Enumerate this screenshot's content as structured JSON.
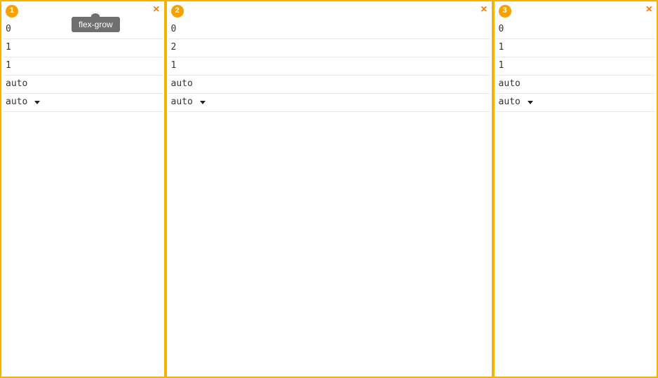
{
  "tooltip": "flex-grow",
  "columns": [
    {
      "index": "1",
      "close": "×",
      "fields": {
        "order": "0",
        "flex_grow": "1",
        "flex_shrink": "1",
        "flex_basis": "auto",
        "align_self": "auto"
      }
    },
    {
      "index": "2",
      "close": "×",
      "fields": {
        "order": "0",
        "flex_grow": "2",
        "flex_shrink": "1",
        "flex_basis": "auto",
        "align_self": "auto"
      }
    },
    {
      "index": "3",
      "close": "×",
      "fields": {
        "order": "0",
        "flex_grow": "1",
        "flex_shrink": "1",
        "flex_basis": "auto",
        "align_self": "auto"
      }
    }
  ]
}
